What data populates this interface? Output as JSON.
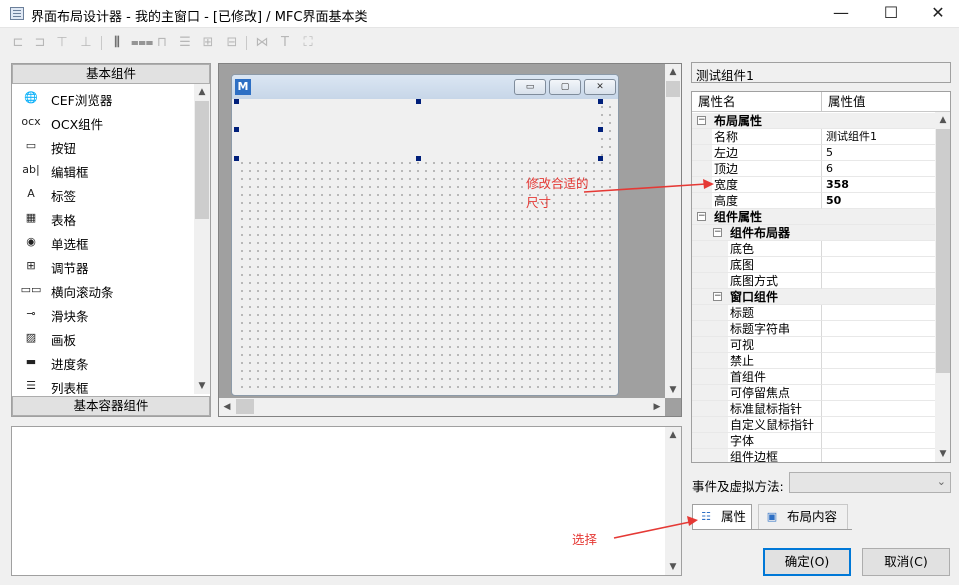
{
  "window": {
    "title": "界面布局设计器 - 我的主窗口 - [已修改] / MFC界面基本类",
    "minimize": "—",
    "maximize": "☐",
    "close": "✕"
  },
  "toolbar": {
    "icons": [
      "align-left-icon",
      "align-right-icon",
      "align-top-icon",
      "align-bottom-icon",
      "center-horizontal-icon",
      "center-vertical-icon",
      "same-width-icon",
      "same-height-icon",
      "same-size-icon",
      "space-horizontal-icon",
      "space-vertical-icon",
      "tab-order-icon",
      "text-icon",
      "fullscreen-icon"
    ]
  },
  "components": {
    "basic_header": "基本组件",
    "container_header": "基本容器组件",
    "items": [
      {
        "icon": "🌐",
        "icon_name": "browser-icon",
        "label": "CEF浏览器"
      },
      {
        "icon": "ocx",
        "icon_name": "ocx-icon",
        "label": "OCX组件"
      },
      {
        "icon": "▭",
        "icon_name": "button-icon",
        "label": "按钮"
      },
      {
        "icon": "ab|",
        "icon_name": "edit-box-icon",
        "label": "编辑框"
      },
      {
        "icon": "A",
        "icon_name": "label-icon",
        "label": "标签"
      },
      {
        "icon": "▦",
        "icon_name": "table-icon",
        "label": "表格"
      },
      {
        "icon": "◉",
        "icon_name": "radio-icon",
        "label": "单选框"
      },
      {
        "icon": "⊞",
        "icon_name": "spinner-icon",
        "label": "调节器"
      },
      {
        "icon": "▭▭",
        "icon_name": "hscrollbar-icon",
        "label": "横向滚动条"
      },
      {
        "icon": "⊸",
        "icon_name": "slider-icon",
        "label": "滑块条"
      },
      {
        "icon": "▨",
        "icon_name": "canvas-icon",
        "label": "画板"
      },
      {
        "icon": "▬",
        "icon_name": "progress-icon",
        "label": "进度条"
      },
      {
        "icon": "☰",
        "icon_name": "listbox-icon",
        "label": "列表框"
      }
    ]
  },
  "design": {
    "window_icon_letter": "M",
    "min_glyph": "▭",
    "max_glyph": "▢",
    "close_glyph": "✕"
  },
  "props": {
    "component_name": "测试组件1",
    "header_name": "属性名",
    "header_value": "属性值",
    "rows": [
      {
        "name": "布局属性",
        "value": "",
        "level": 0,
        "category": true,
        "expander": "−"
      },
      {
        "name": "名称",
        "value": "测试组件1",
        "level": 1,
        "category": false
      },
      {
        "name": "左边",
        "value": "5",
        "level": 1,
        "category": false
      },
      {
        "name": "顶边",
        "value": "6",
        "level": 1,
        "category": false
      },
      {
        "name": "宽度",
        "value": "358",
        "level": 1,
        "category": false,
        "bold": true
      },
      {
        "name": "高度",
        "value": "50",
        "level": 1,
        "category": false,
        "bold": true
      },
      {
        "name": "组件属性",
        "value": "",
        "level": 0,
        "category": true,
        "expander": "−"
      },
      {
        "name": "组件布局器",
        "value": "",
        "level": 1,
        "category": true,
        "expander": "−"
      },
      {
        "name": "底色",
        "value": "",
        "level": 2,
        "category": false
      },
      {
        "name": "底图",
        "value": "",
        "level": 2,
        "category": false
      },
      {
        "name": "底图方式",
        "value": "",
        "level": 2,
        "category": false
      },
      {
        "name": "窗口组件",
        "value": "",
        "level": 1,
        "category": true,
        "expander": "−"
      },
      {
        "name": "标题",
        "value": "",
        "level": 2,
        "category": false
      },
      {
        "name": "标题字符串",
        "value": "",
        "level": 2,
        "category": false
      },
      {
        "name": "可视",
        "value": "",
        "level": 2,
        "category": false
      },
      {
        "name": "禁止",
        "value": "",
        "level": 2,
        "category": false
      },
      {
        "name": "首组件",
        "value": "",
        "level": 2,
        "category": false
      },
      {
        "name": "可停留焦点",
        "value": "",
        "level": 2,
        "category": false
      },
      {
        "name": "标准鼠标指针",
        "value": "",
        "level": 2,
        "category": false
      },
      {
        "name": "自定义鼠标指针",
        "value": "",
        "level": 2,
        "category": false
      },
      {
        "name": "字体",
        "value": "",
        "level": 2,
        "category": false
      },
      {
        "name": "组件边框",
        "value": "",
        "level": 2,
        "category": false
      }
    ]
  },
  "events": {
    "label": "事件及虚拟方法:",
    "selected": ""
  },
  "tabs": {
    "properties": "属性",
    "layout": "布局内容"
  },
  "buttons": {
    "ok": "确定(O)",
    "cancel": "取消(C)"
  },
  "annotations": {
    "resize_line1": "修改合适的",
    "resize_line2": "尺寸",
    "select": "选择",
    "color": "#e53935"
  }
}
